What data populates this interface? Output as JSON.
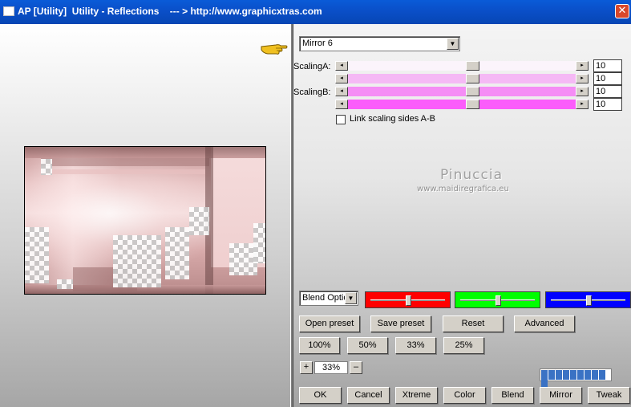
{
  "window": {
    "title": "AP [Utility]  Utility - Reflections    --- > http://www.graphicxtras.com",
    "close_symbol": "✕"
  },
  "preset_dropdown": {
    "selected": "Mirror 6"
  },
  "scaling": {
    "label_a": "ScalingA:",
    "label_b": "ScalingB:",
    "rows": [
      {
        "value": "10",
        "thumb_position": 0.55,
        "color": "#fbf4fb"
      },
      {
        "value": "10",
        "thumb_position": 0.55,
        "color": "#f5b9f5"
      },
      {
        "value": "10",
        "thumb_position": 0.55,
        "color": "#f58df5"
      },
      {
        "value": "10",
        "thumb_position": 0.55,
        "color": "#fb5cfb"
      }
    ]
  },
  "link_scaling": {
    "label": "Link scaling sides A-B",
    "checked": false
  },
  "watermark": {
    "title": "Pinuccia",
    "subtitle": "www.maidiregrafica.eu"
  },
  "blend_dropdown": {
    "selected": "Blend Optio"
  },
  "color_sliders": [
    {
      "name": "red",
      "color": "#ff0000",
      "position": 0.5
    },
    {
      "name": "green",
      "color": "#00ff00",
      "position": 0.5
    },
    {
      "name": "blue",
      "color": "#0000ff",
      "position": 0.5
    }
  ],
  "preset_buttons": {
    "open": "Open preset",
    "save": "Save preset",
    "reset": "Reset",
    "advanced": "Advanced"
  },
  "zoom_buttons": [
    "100%",
    "50%",
    "33%",
    "25%"
  ],
  "zoom": {
    "plus": "+",
    "minus": "–",
    "value": "33%"
  },
  "progress": {
    "fraction": 1.0,
    "segments": 10
  },
  "bottom_buttons": [
    "OK",
    "Cancel",
    "Xtreme",
    "Color",
    "Blend",
    "Mirror",
    "Tweak"
  ],
  "icons": {
    "pointer": "pointing-hand-icon",
    "scroll_left": "◂",
    "scroll_right": "▸",
    "dropdown_arrow": "▼"
  }
}
